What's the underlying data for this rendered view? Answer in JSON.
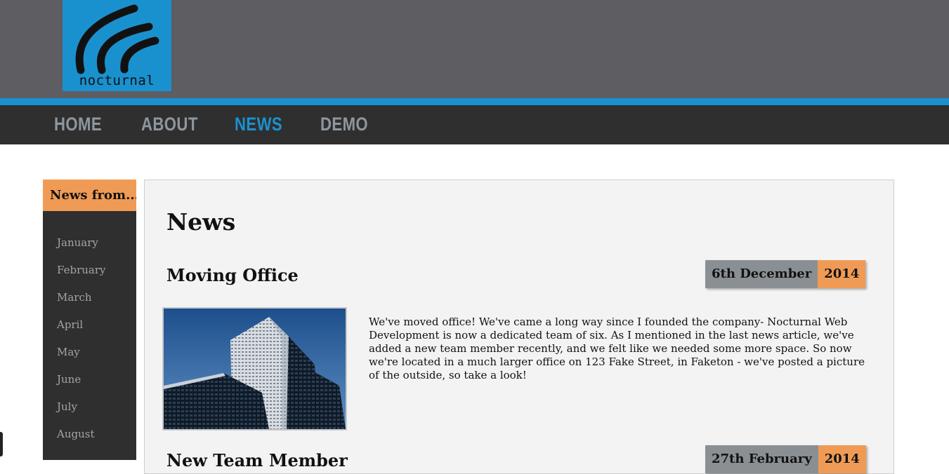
{
  "brand": {
    "logo_text": "nocturnal"
  },
  "colors": {
    "header_bg": "#5e5d62",
    "accent": "#1a91cf",
    "nav_bg": "#2f2f2f",
    "highlight": "#ef9b55",
    "date_bg": "#8a8f93"
  },
  "nav": {
    "items": [
      {
        "label": "HOME",
        "active": false
      },
      {
        "label": "ABOUT",
        "active": false
      },
      {
        "label": "NEWS",
        "active": true
      },
      {
        "label": "DEMO",
        "active": false
      }
    ]
  },
  "sidebar": {
    "title": "News from...",
    "months": [
      "January",
      "February",
      "March",
      "April",
      "May",
      "June",
      "July",
      "August"
    ]
  },
  "main": {
    "title": "News",
    "articles": [
      {
        "title": "Moving Office",
        "date_day": "6th December",
        "date_year": "2014",
        "body": "We've moved office! We've came a long way since I founded the company- Nocturnal Web Development is now a dedicated team of six. As I mentioned in the last news article, we've added a new team member recently, and we felt like we needed some more space. So now we're located in a much larger office on 123 Fake Street, in Faketon - we've posted a picture of the outside, so take a look!"
      },
      {
        "title": "New Team Member",
        "date_day": "27th February",
        "date_year": "2014"
      }
    ]
  }
}
